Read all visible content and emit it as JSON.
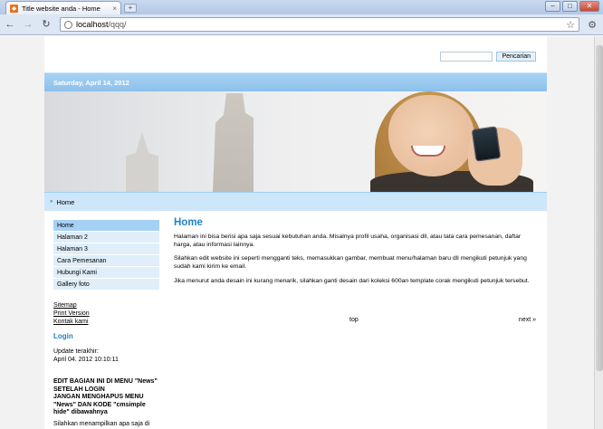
{
  "browser": {
    "tab_title": "Title website anda - Home",
    "tab_close": "×",
    "new_tab": "+",
    "favicon": "html-favicon",
    "window_buttons": [
      "–",
      "□",
      "✕"
    ],
    "url_host": "localhost",
    "url_path": "/qqq/"
  },
  "header": {
    "search_placeholder": "",
    "search_button": "Pencarian",
    "date": "Saturday, April 14, 2012"
  },
  "breadcrumb": {
    "label": "Home"
  },
  "menu": {
    "items": [
      {
        "label": "Home",
        "active": true
      },
      {
        "label": "Halaman 2"
      },
      {
        "label": "Halaman 3"
      },
      {
        "label": "Cara Pemesanan"
      },
      {
        "label": "Hubungi Kami"
      },
      {
        "label": "Gallery foto"
      }
    ]
  },
  "side_links": [
    "Sitemap",
    "Print Version",
    "Kontak kami"
  ],
  "login": {
    "title": "Login",
    "update_label": "Update terakhir:",
    "update_value": "April 04. 2012 10:10:11"
  },
  "edit_note": {
    "line1": "EDIT BAGIAN INI DI MENU \"News\"",
    "line2": "SETELAH LOGIN",
    "line3": "JANGAN MENGHAPUS MENU",
    "line4": "\"News\" DAN KODE \"cmsimple",
    "line5": "hide\" dibawahnya"
  },
  "more_text": "Silahkan menampilkan apa saja di",
  "content": {
    "title": "Home",
    "p1": "Halaman ini bisa berisi apa saja sesuai kebutuhan anda. Misalnya profil usaha, organisasi dll, atau tata cara pemesanan, daftar harga, atau informasi lainnya.",
    "p2": "Silahkan edit website ini seperti mengganti teks, memasukkan gambar, membuat menu/halaman baru dll mengikuti petunjuk yang sudah kami kirim ke email.",
    "p3": "Jika menurut anda desain ini kurang menarik, silahkan ganti desain dari koleksi 600an template corak mengikuti petunjuk tersebut."
  },
  "pager": {
    "top": "top",
    "next": "next »"
  },
  "colors": {
    "accent": "#1f82c4",
    "datebar": "#8cc0ea",
    "menu_active": "#a5d1f4",
    "menu_item": "#dfeef9"
  }
}
